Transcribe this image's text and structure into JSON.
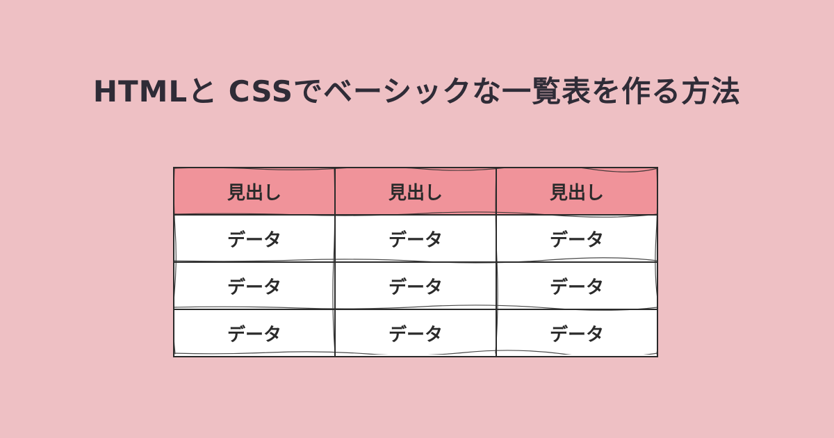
{
  "title": "HTMLと CSSでベーシックな一覧表を作る方法",
  "table": {
    "headers": [
      "見出し",
      "見出し",
      "見出し"
    ],
    "rows": [
      [
        "データ",
        "データ",
        "データ"
      ],
      [
        "データ",
        "データ",
        "データ"
      ],
      [
        "データ",
        "データ",
        "データ"
      ]
    ]
  },
  "colors": {
    "background": "#eec0c4",
    "header_fill": "#f0939a",
    "cell_fill": "#ffffff",
    "border": "#2a2a2a",
    "title_text": "#2f2c37"
  }
}
